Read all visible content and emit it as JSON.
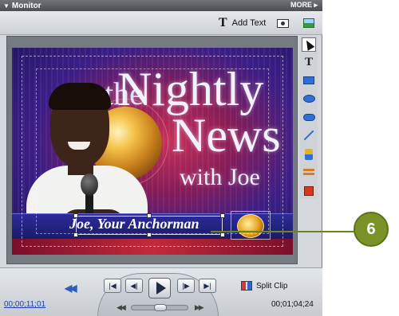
{
  "window": {
    "title": "Monitor",
    "more_label": "MORE"
  },
  "toolbar": {
    "add_text_label": "Add Text",
    "add_text_icon": "text-T-icon",
    "camera_icon": "camera-icon",
    "image_icon": "image-icon"
  },
  "video": {
    "logo_the": "the",
    "logo_nightly": "Nightly",
    "logo_news": "News",
    "logo_with": "with Joe",
    "lower_third_text": "Joe, Your Anchorman"
  },
  "tools": [
    {
      "name": "selection-tool",
      "icon": "arrow-pointer-icon",
      "active": true
    },
    {
      "name": "text-tool",
      "icon": "text-T-icon"
    },
    {
      "name": "rectangle-tool",
      "icon": "rectangle-icon"
    },
    {
      "name": "ellipse-tool",
      "icon": "ellipse-icon"
    },
    {
      "name": "rounded-rectangle-tool",
      "icon": "rounded-rectangle-icon"
    },
    {
      "name": "line-tool",
      "icon": "line-icon"
    },
    {
      "name": "color-tool",
      "icon": "color-swatch-icon"
    },
    {
      "name": "align-tool",
      "icon": "align-icon"
    },
    {
      "name": "stop-tool",
      "icon": "stop-square-icon"
    }
  ],
  "transport": {
    "split_clip_label": "Split Clip",
    "current_timecode": "00;00;11;01",
    "duration_timecode": "00;01;04;24"
  },
  "callout": {
    "number": "6"
  },
  "colors": {
    "callout": "#7a9227",
    "accent_blue": "#2f6fd6",
    "timecode_link": "#1f3fae"
  }
}
